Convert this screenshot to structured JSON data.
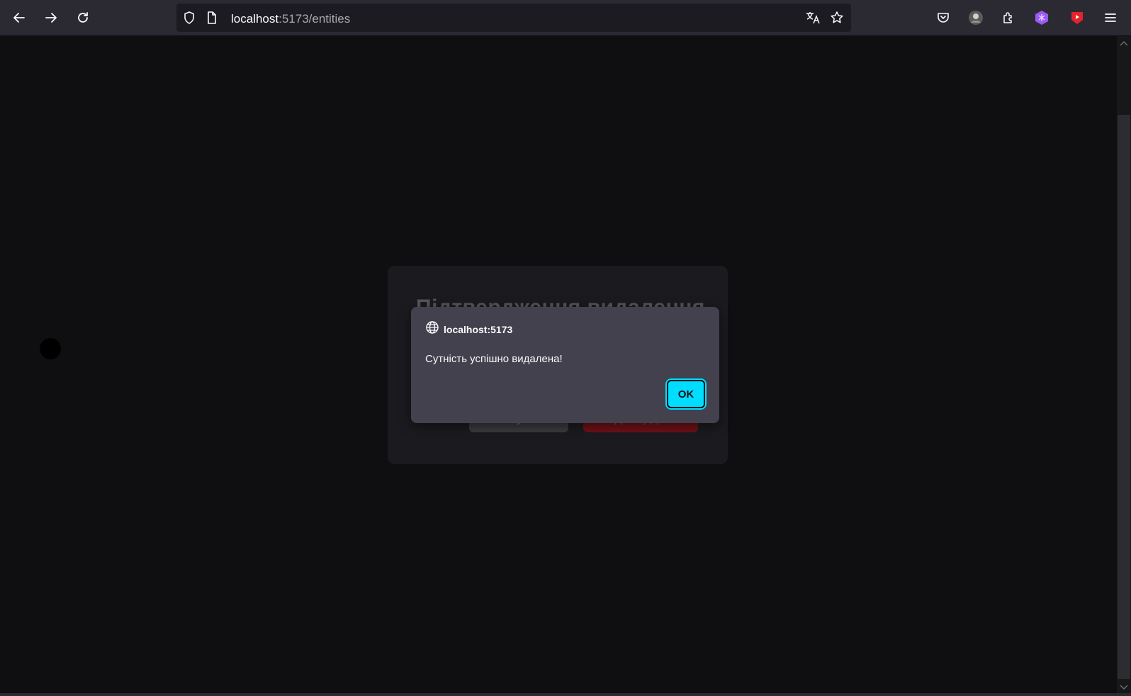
{
  "browser": {
    "url_host": "localhost",
    "url_rest": ":5173/entities",
    "icons": {
      "back": "arrow-left-icon",
      "forward": "arrow-right-icon",
      "reload": "reload-icon",
      "shield": "shield-icon",
      "page": "page-icon",
      "translate": "translate-icon",
      "bookmark": "star-icon",
      "pocket": "pocket-icon",
      "profile": "avatar",
      "extensions": "puzzle-icon",
      "extension_purple": "extension-icon",
      "extension_youtube": "youtube-icon",
      "menu": "hamburger-menu-icon"
    }
  },
  "app_modal": {
    "title": "Підтвердження видалення",
    "cancel_label": "Скасувати",
    "confirm_label": "Підтвердити"
  },
  "alert": {
    "origin": "localhost:5173",
    "message": "Сутність успішно видалена!",
    "ok_label": "OK"
  },
  "colors": {
    "accent": "#00ddff",
    "toolbar_bg": "#2b2a33",
    "dialog_bg": "#42414d",
    "page_bg": "#0f0f12"
  }
}
